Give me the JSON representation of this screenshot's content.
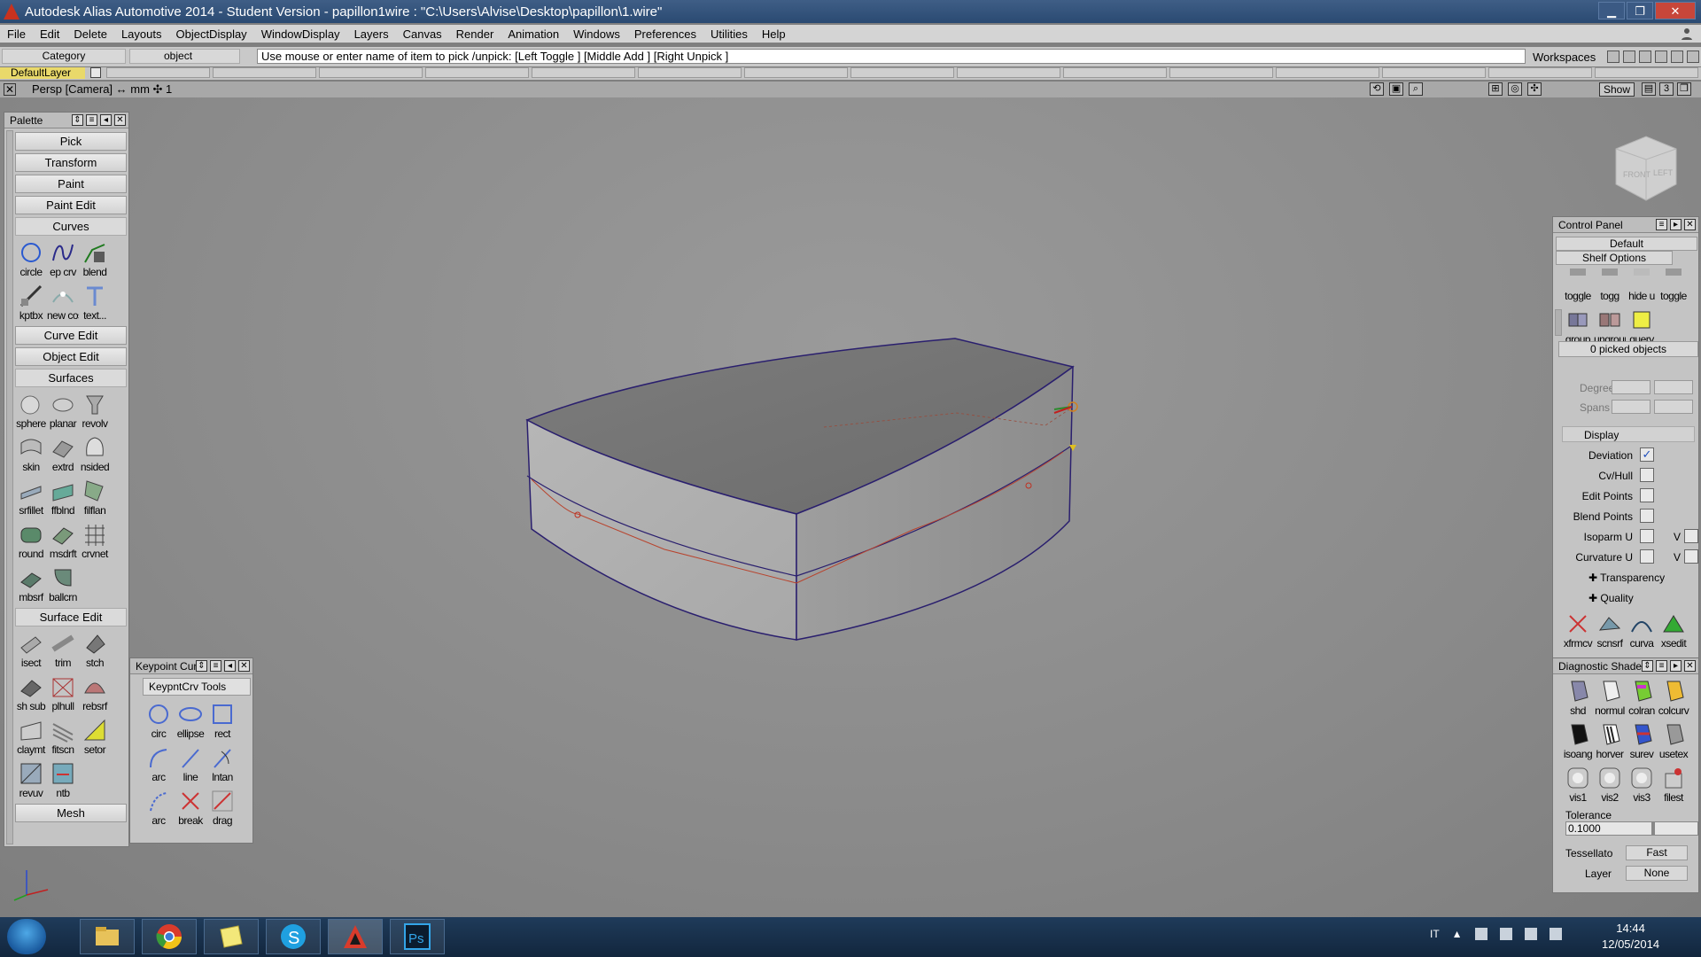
{
  "window": {
    "title": "Autodesk Alias Automotive 2014   - Student Version   - papillon1wire : \"C:\\Users\\Alvise\\Desktop\\papillon\\1.wire\"",
    "min_glyph": "▁",
    "max_glyph": "❐",
    "close_glyph": "✕"
  },
  "menu": [
    "File",
    "Edit",
    "Delete",
    "Layouts",
    "ObjectDisplay",
    "WindowDisplay",
    "Layers",
    "Canvas",
    "Render",
    "Animation",
    "Windows",
    "Preferences",
    "Utilities",
    "Help"
  ],
  "prompt": {
    "category": "Category",
    "object": "object",
    "message": "Use mouse or enter name of item to pick /unpick: [Left Toggle ] [Middle Add ] [Right Unpick ]",
    "workspaces": "Workspaces"
  },
  "layers": {
    "default": "DefaultLayer"
  },
  "viewport": {
    "camera_label": "Persp [Camera]  ↔ mm   ✣ 1",
    "show_label": "Show",
    "close_glyph": "✕",
    "viewcube_front": "FRONT",
    "viewcube_left": "LEFT"
  },
  "palette": {
    "title": "Palette",
    "buttons": {
      "pick": "Pick",
      "transform": "Transform",
      "paint": "Paint",
      "paint_edit": "Paint Edit",
      "curve_edit": "Curve Edit",
      "object_edit": "Object Edit",
      "mesh": "Mesh"
    },
    "curves_label": "Curves",
    "surfaces_label": "Surfaces",
    "surface_edit_label": "Surface Edit",
    "curves": [
      "circle",
      "ep crv",
      "blend",
      "kptbx",
      "new cos",
      "text..."
    ],
    "surfaces": [
      "sphere",
      "planar",
      "revolv",
      "skin",
      "extrd",
      "nsided",
      "srfillet",
      "ffblnd",
      "filflan",
      "round",
      "msdrft",
      "crvnet",
      "mbsrf",
      "ballcrn"
    ],
    "surface_edit": [
      "isect",
      "trim",
      "stch",
      "sh sub",
      "plhull",
      "rebsrf",
      "claymt",
      "fitscn",
      "setor",
      "revuv",
      "ntb"
    ]
  },
  "keypoint": {
    "title": "Keypoint Cur",
    "tab": "KeypntCrv Tools",
    "tools": [
      "circ",
      "ellipse",
      "rect",
      "arc",
      "line",
      "lntan",
      "arc",
      "break",
      "drag"
    ]
  },
  "control_panel": {
    "title": "Control Panel",
    "default": "Default",
    "shelf_options": "Shelf Options",
    "shelf": [
      "toggle",
      "togg",
      "hide u",
      "toggle",
      "group",
      "ungroup",
      "query"
    ],
    "picked": "0 picked objects",
    "degree": "Degree",
    "spans": "Spans",
    "display": "Display",
    "rows": [
      {
        "label": "Deviation",
        "checked": "✓"
      },
      {
        "label": "Cv/Hull",
        "checked": ""
      },
      {
        "label": "Edit Points",
        "checked": ""
      },
      {
        "label": "Blend Points",
        "checked": ""
      },
      {
        "label": "Isoparm U",
        "checked": ""
      },
      {
        "label": "Curvature U",
        "checked": ""
      }
    ],
    "v_label": "V",
    "transparency": "Transparency",
    "quality": "Quality",
    "bottom_tools": [
      "xfrmcv",
      "scnsrf",
      "curva",
      "xsedit"
    ]
  },
  "diagnostic": {
    "title": "Diagnostic Shade",
    "tools": [
      "shd",
      "normul",
      "colran",
      "colcurv",
      "isoang",
      "horver",
      "surev",
      "usetex",
      "vis1",
      "vis2",
      "vis3",
      "filest"
    ],
    "tolerance_label": "Tolerance",
    "tolerance_value": "0.1000",
    "tessellator_label": "Tessellato",
    "tessellator_value": "Fast",
    "layer_label": "Layer",
    "layer_value": "None"
  },
  "taskbar": {
    "lang": "IT",
    "time": "14:44",
    "date": "12/05/2014"
  },
  "colors": {
    "title_bar": "#2f4f78",
    "viewport_bg": "#8a8a8a",
    "layer_highlight": "#e9d96a",
    "model_outline": "#2a1f6e",
    "model_curve": "#b8442e"
  }
}
